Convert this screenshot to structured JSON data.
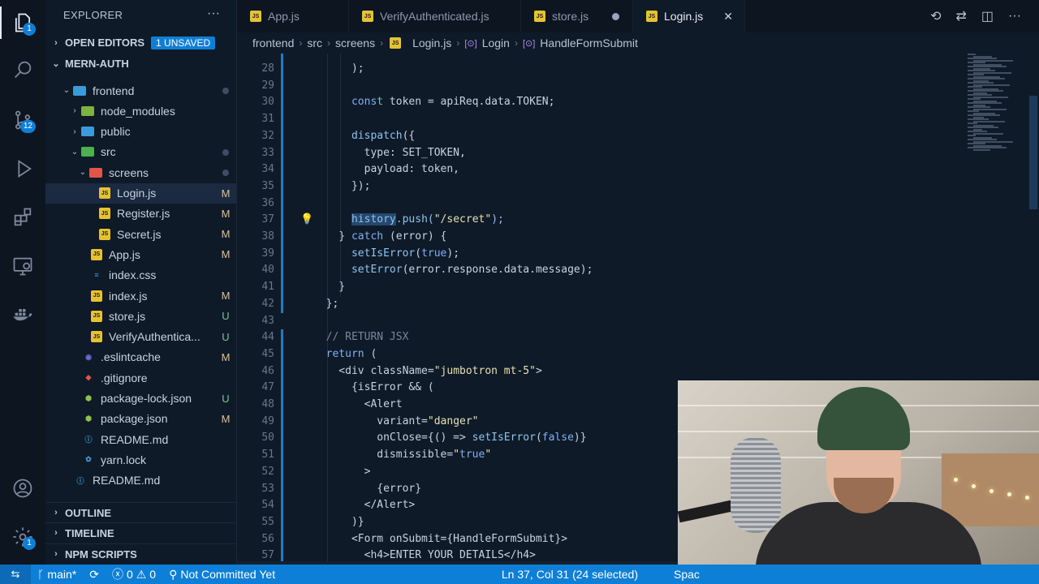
{
  "activity_bar": {
    "items": [
      {
        "icon": "explorer-icon",
        "badge": "1"
      },
      {
        "icon": "search-icon",
        "badge": ""
      },
      {
        "icon": "source-control-icon",
        "badge": "12"
      },
      {
        "icon": "run-debug-icon",
        "badge": ""
      },
      {
        "icon": "extensions-icon",
        "badge": ""
      },
      {
        "icon": "remote-explorer-icon",
        "badge": ""
      },
      {
        "icon": "docker-icon",
        "badge": ""
      }
    ],
    "bottom": [
      {
        "icon": "account-icon",
        "badge": ""
      },
      {
        "icon": "settings-gear-icon",
        "badge": "1"
      }
    ]
  },
  "sidebar": {
    "title": "EXPLORER",
    "open_editors": {
      "label": "OPEN EDITORS",
      "badge": "1 UNSAVED"
    },
    "project": "MERN-AUTH",
    "tree": [
      {
        "name": "frontend",
        "type": "folder",
        "indent": 1,
        "open": true,
        "status": "dot",
        "color": "#3b9bd8"
      },
      {
        "name": "node_modules",
        "type": "folder",
        "indent": 2,
        "open": false,
        "status": "",
        "color": "#7cb342"
      },
      {
        "name": "public",
        "type": "folder",
        "indent": 2,
        "open": false,
        "status": "",
        "color": "#3b9bd8"
      },
      {
        "name": "src",
        "type": "folder",
        "indent": 2,
        "open": true,
        "status": "dot",
        "color": "#4caf50"
      },
      {
        "name": "screens",
        "type": "folder",
        "indent": 3,
        "open": true,
        "status": "dot",
        "color": "#e5534b"
      },
      {
        "name": "Login.js",
        "type": "js",
        "indent": 4,
        "status": "M",
        "selected": true
      },
      {
        "name": "Register.js",
        "type": "js",
        "indent": 4,
        "status": "M"
      },
      {
        "name": "Secret.js",
        "type": "js",
        "indent": 4,
        "status": "M"
      },
      {
        "name": "App.js",
        "type": "js",
        "indent": 3,
        "status": "M"
      },
      {
        "name": "index.css",
        "type": "css",
        "indent": 3,
        "status": ""
      },
      {
        "name": "index.js",
        "type": "js",
        "indent": 3,
        "status": "M"
      },
      {
        "name": "store.js",
        "type": "js",
        "indent": 3,
        "status": "U"
      },
      {
        "name": "VerifyAuthentica...",
        "type": "js",
        "indent": 3,
        "status": "U"
      },
      {
        "name": ".eslintcache",
        "type": "cache",
        "indent": 2,
        "status": "M"
      },
      {
        "name": ".gitignore",
        "type": "git",
        "indent": 2,
        "status": ""
      },
      {
        "name": "package-lock.json",
        "type": "json",
        "indent": 2,
        "status": "U"
      },
      {
        "name": "package.json",
        "type": "json",
        "indent": 2,
        "status": "M"
      },
      {
        "name": "README.md",
        "type": "info",
        "indent": 2,
        "status": ""
      },
      {
        "name": "yarn.lock",
        "type": "yarn",
        "indent": 2,
        "status": ""
      },
      {
        "name": "README.md",
        "type": "info",
        "indent": 1,
        "status": ""
      }
    ],
    "outline": "OUTLINE",
    "timeline": "TIMELINE",
    "npm_scripts": "NPM SCRIPTS"
  },
  "tabs": [
    {
      "label": "App.js",
      "state": ""
    },
    {
      "label": "VerifyAuthenticated.js",
      "state": ""
    },
    {
      "label": "store.js",
      "state": "dirty"
    },
    {
      "label": "Login.js",
      "state": "active"
    }
  ],
  "breadcrumb": [
    "frontend",
    "src",
    "screens",
    "Login.js",
    "Login",
    "HandleFormSubmit"
  ],
  "code_lines": [
    {
      "n": "28",
      "t": "      );"
    },
    {
      "n": "29",
      "t": ""
    },
    {
      "n": "30",
      "t": "      const token = apiReq.data.TOKEN;"
    },
    {
      "n": "31",
      "t": ""
    },
    {
      "n": "32",
      "t": "      dispatch({"
    },
    {
      "n": "33",
      "t": "        type: SET_TOKEN,"
    },
    {
      "n": "34",
      "t": "        payload: token,"
    },
    {
      "n": "35",
      "t": "      });"
    },
    {
      "n": "36",
      "t": ""
    },
    {
      "n": "37",
      "t": "      history.push(\"/secret\");"
    },
    {
      "n": "38",
      "t": "    } catch (error) {"
    },
    {
      "n": "39",
      "t": "      setIsError(true);"
    },
    {
      "n": "40",
      "t": "      setError(error.response.data.message);"
    },
    {
      "n": "41",
      "t": "    }"
    },
    {
      "n": "42",
      "t": "  };"
    },
    {
      "n": "43",
      "t": ""
    },
    {
      "n": "44",
      "t": "  // RETURN JSX"
    },
    {
      "n": "45",
      "t": "  return ("
    },
    {
      "n": "46",
      "t": "    <div className=\"jumbotron mt-5\">"
    },
    {
      "n": "47",
      "t": "      {isError && ("
    },
    {
      "n": "48",
      "t": "        <Alert"
    },
    {
      "n": "49",
      "t": "          variant=\"danger\""
    },
    {
      "n": "50",
      "t": "          onClose={() => setIsError(false)}"
    },
    {
      "n": "51",
      "t": "          dismissible=\"true\""
    },
    {
      "n": "52",
      "t": "        >"
    },
    {
      "n": "53",
      "t": "          {error}"
    },
    {
      "n": "54",
      "t": "        </Alert>"
    },
    {
      "n": "55",
      "t": "      )}"
    },
    {
      "n": "56",
      "t": "      <Form onSubmit={HandleFormSubmit}>"
    },
    {
      "n": "57",
      "t": "        <h4>ENTER YOUR DETAILS</h4>"
    }
  ],
  "status_bar": {
    "branch": "main*",
    "errors": "0",
    "warnings": "0",
    "git_status": "Not Committed Yet",
    "cursor": "Ln 37, Col 31 (24 selected)",
    "spaces": "Spac"
  },
  "colors": {
    "accent": "#0e7fd6",
    "modified": "#e2c08d",
    "untracked": "#73c991"
  }
}
